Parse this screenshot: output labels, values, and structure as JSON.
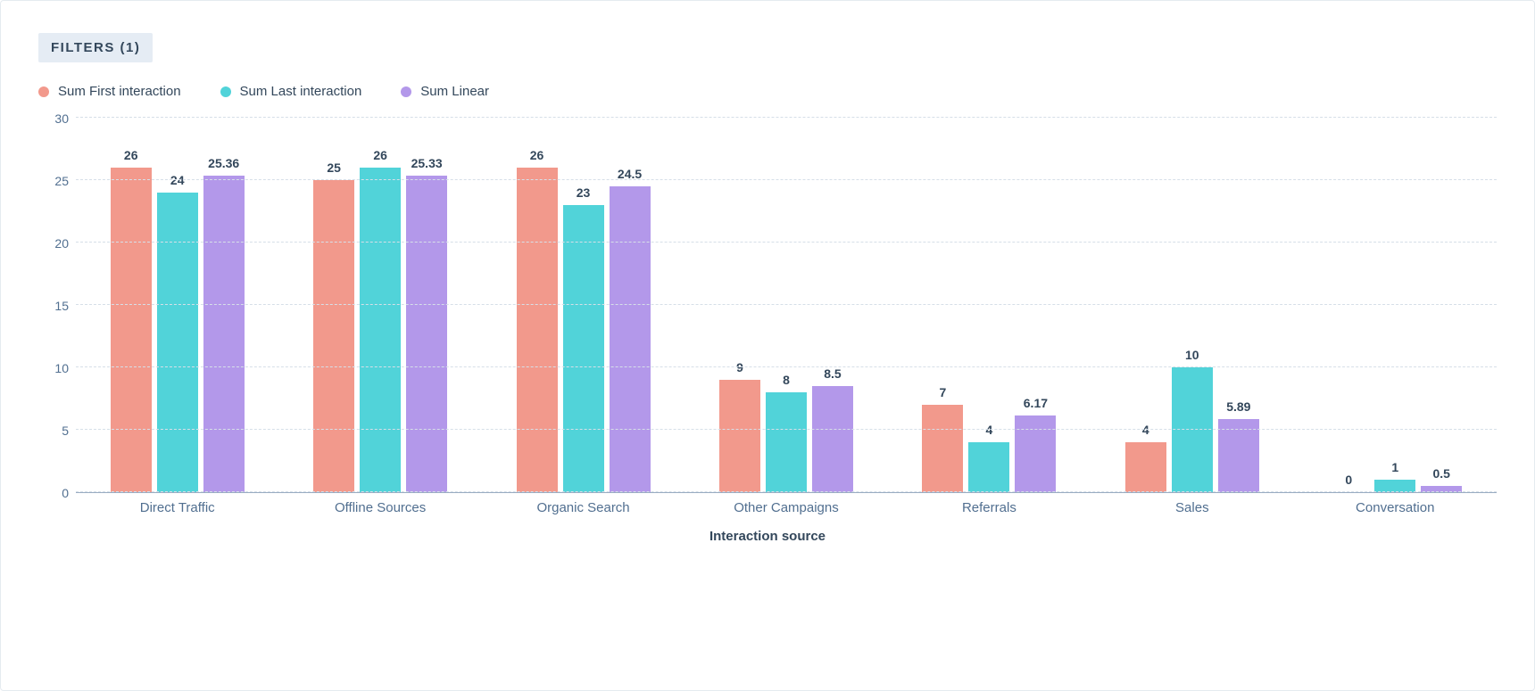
{
  "filters_label": "FILTERS (1)",
  "legend": [
    {
      "label": "Sum First interaction",
      "color": "#f2998c"
    },
    {
      "label": "Sum Last interaction",
      "color": "#51d3d9"
    },
    {
      "label": "Sum Linear",
      "color": "#b398ea"
    }
  ],
  "colors": {
    "first": "#f2998c",
    "last": "#51d3d9",
    "linear": "#b398ea"
  },
  "chart_data": {
    "type": "bar",
    "xlabel": "Interaction source",
    "ylabel": "",
    "ylim": [
      0,
      30
    ],
    "yticks": [
      0,
      5,
      10,
      15,
      20,
      25,
      30
    ],
    "categories": [
      "Direct Traffic",
      "Offline Sources",
      "Organic Search",
      "Other Campaigns",
      "Referrals",
      "Sales",
      "Conversation"
    ],
    "series": [
      {
        "name": "Sum First interaction",
        "values": [
          26,
          25,
          26,
          9,
          7,
          4,
          0
        ]
      },
      {
        "name": "Sum Last interaction",
        "values": [
          24,
          26,
          23,
          8,
          4,
          10,
          1
        ]
      },
      {
        "name": "Sum Linear",
        "values": [
          25.36,
          25.33,
          24.5,
          8.5,
          6.17,
          5.89,
          0.5
        ]
      }
    ]
  }
}
